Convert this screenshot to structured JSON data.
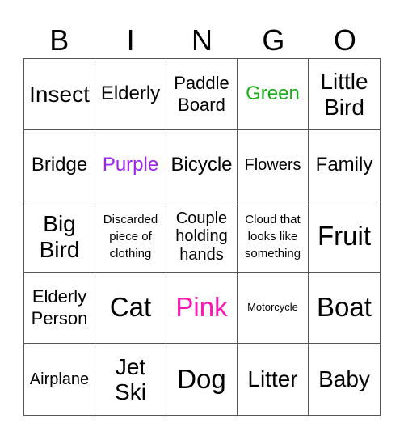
{
  "header": {
    "letters": [
      "B",
      "I",
      "N",
      "G",
      "O"
    ]
  },
  "colors": {
    "green": "#1aaa1a",
    "purple": "#a020f0",
    "pink": "#ff14b4",
    "default": "#000000"
  },
  "cells": [
    {
      "text": "Insect",
      "size": "s-l",
      "color": "default"
    },
    {
      "text": "Elderly",
      "size": "s-m",
      "color": "default"
    },
    {
      "text": "Paddle Board",
      "size": "s-ms",
      "color": "default"
    },
    {
      "text": "Green",
      "size": "s-m",
      "color": "green"
    },
    {
      "text": "Little Bird",
      "size": "s-l",
      "color": "default"
    },
    {
      "text": "Bridge",
      "size": "s-m",
      "color": "default"
    },
    {
      "text": "Purple",
      "size": "s-m",
      "color": "purple"
    },
    {
      "text": "Bicycle",
      "size": "s-m",
      "color": "default"
    },
    {
      "text": "Flowers",
      "size": "s-s",
      "color": "default"
    },
    {
      "text": "Family",
      "size": "s-m",
      "color": "default"
    },
    {
      "text": "Big Bird",
      "size": "s-l",
      "color": "default"
    },
    {
      "text": "Discarded piece of clothing",
      "size": "s-xs",
      "color": "default"
    },
    {
      "text": "Couple holding hands",
      "size": "s-s",
      "color": "default"
    },
    {
      "text": "Cloud that looks like something",
      "size": "s-xs",
      "color": "default"
    },
    {
      "text": "Fruit",
      "size": "s-xl",
      "color": "default"
    },
    {
      "text": "Elderly Person",
      "size": "s-ms",
      "color": "default"
    },
    {
      "text": "Cat",
      "size": "s-xl",
      "color": "default"
    },
    {
      "text": "Pink",
      "size": "s-xl",
      "color": "pink"
    },
    {
      "text": "Motorcycle",
      "size": "s-xxs",
      "color": "default"
    },
    {
      "text": "Boat",
      "size": "s-xl",
      "color": "default"
    },
    {
      "text": "Airplane",
      "size": "s-s",
      "color": "default"
    },
    {
      "text": "Jet Ski",
      "size": "s-l",
      "color": "default"
    },
    {
      "text": "Dog",
      "size": "s-xl",
      "color": "default"
    },
    {
      "text": "Litter",
      "size": "s-l",
      "color": "default"
    },
    {
      "text": "Baby",
      "size": "s-l",
      "color": "default"
    }
  ]
}
